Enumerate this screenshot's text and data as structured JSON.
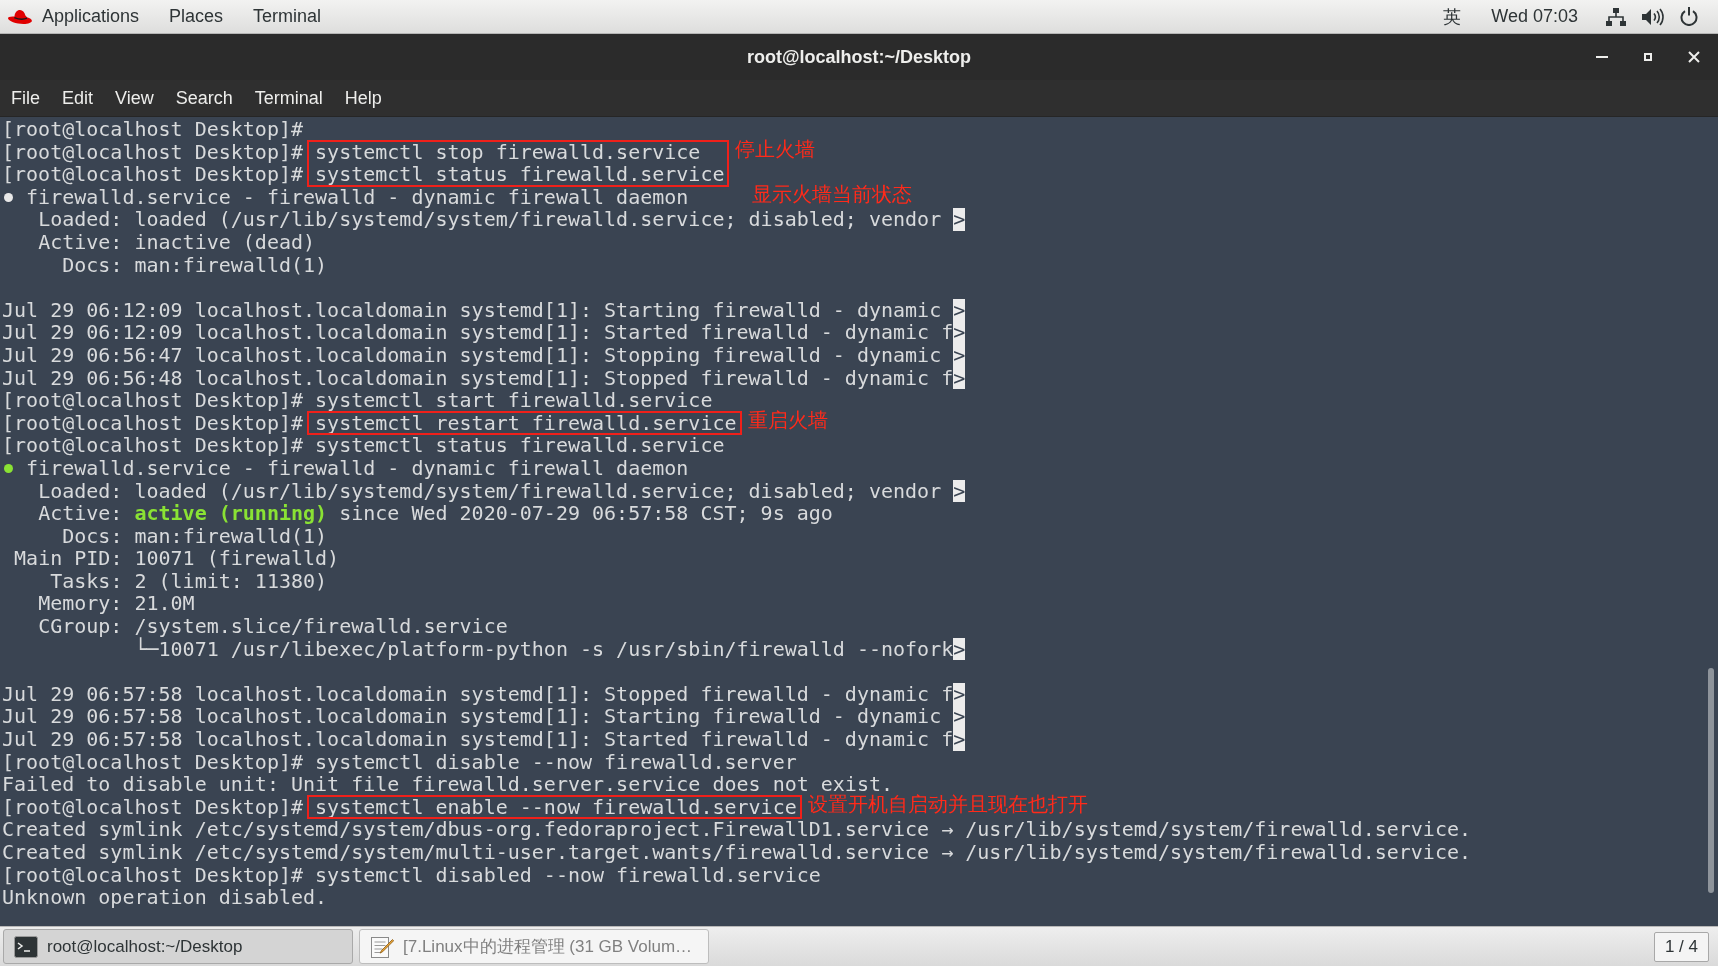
{
  "top_bar": {
    "menus": [
      {
        "label": "Applications",
        "kind": "launcher"
      },
      {
        "label": "Places",
        "kind": "menu"
      },
      {
        "label": "Terminal",
        "kind": "menu"
      }
    ],
    "input_method": "英",
    "clock": "Wed 07:03"
  },
  "window": {
    "title": "root@localhost:~/Desktop",
    "menus": [
      "File",
      "Edit",
      "View",
      "Search",
      "Terminal",
      "Help"
    ]
  },
  "terminal": {
    "lines": [
      {
        "kind": "prompt",
        "prompt": "[root@localhost Desktop]#",
        "boxed": false
      },
      {
        "kind": "prompt",
        "prompt": "[root@localhost Desktop]#",
        "command": "systemctl stop firewalld.service",
        "boxed": true,
        "note": "停止火墙"
      },
      {
        "kind": "prompt",
        "prompt": "[root@localhost Desktop]#",
        "command": "systemctl status firewalld.service",
        "boxed": true
      },
      {
        "kind": "status",
        "color": "#e8e8e8",
        "text": "firewalld.service - firewalld - dynamic firewall daemon",
        "boxed": false,
        "note": "显示火墙当前状态"
      },
      {
        "kind": "output",
        "text": "   Loaded: loaded (/usr/lib/systemd/system/firewalld.service; disabled; vendor ",
        "cut_mark": ">",
        "boxed": false
      },
      {
        "kind": "output",
        "text": "   Active: inactive (dead)",
        "boxed": false
      },
      {
        "kind": "output",
        "text": "     Docs: man:firewalld(1)",
        "boxed": false
      },
      {
        "kind": "blank"
      },
      {
        "kind": "output",
        "text": "Jul 29 06:12:09 localhost.localdomain systemd[1]: Starting firewalld - dynamic ",
        "cut_mark": ">",
        "boxed": false
      },
      {
        "kind": "output",
        "text": "Jul 29 06:12:09 localhost.localdomain systemd[1]: Started firewalld - dynamic f",
        "cut_mark": ">",
        "boxed": false
      },
      {
        "kind": "output",
        "text": "Jul 29 06:56:47 localhost.localdomain systemd[1]: Stopping firewalld - dynamic ",
        "cut_mark": ">",
        "boxed": false
      },
      {
        "kind": "output",
        "text": "Jul 29 06:56:48 localhost.localdomain systemd[1]: Stopped firewalld - dynamic f",
        "cut_mark": ">",
        "boxed": false
      },
      {
        "kind": "prompt",
        "prompt": "[root@localhost Desktop]#",
        "command": "systemctl start firewalld.service",
        "boxed": false
      },
      {
        "kind": "prompt",
        "prompt": "[root@localhost Desktop]#",
        "command": "systemctl restart firewalld.service",
        "boxed": true,
        "note": "重启火墙"
      },
      {
        "kind": "prompt",
        "prompt": "[root@localhost Desktop]#",
        "command": "systemctl status firewalld.service",
        "boxed": false
      },
      {
        "kind": "status",
        "color": "#8ae234",
        "text": "firewalld.service - firewalld - dynamic firewall daemon",
        "boxed": false
      },
      {
        "kind": "output",
        "text": "   Loaded: loaded (/usr/lib/systemd/system/firewalld.service; disabled; vendor ",
        "cut_mark": ">",
        "boxed": false
      },
      {
        "kind": "output",
        "text": "   Active: **active (running)** since Wed 2020-07-29 06:57:58 CST; 9s ago",
        "boxed": false
      },
      {
        "kind": "output",
        "text": "     Docs: man:firewalld(1)",
        "boxed": false
      },
      {
        "kind": "output",
        "text": " Main PID: 10071 (firewalld)",
        "boxed": false
      },
      {
        "kind": "output",
        "text": "    Tasks: 2 (limit: 11380)",
        "boxed": false
      },
      {
        "kind": "output",
        "text": "   Memory: 21.0M",
        "boxed": false
      },
      {
        "kind": "output",
        "text": "   CGroup: /system.slice/firewalld.service",
        "boxed": false
      },
      {
        "kind": "output",
        "text": "           └─10071 /usr/libexec/platform-python -s /usr/sbin/firewalld --nofork",
        "cut_mark": ">",
        "boxed": false
      },
      {
        "kind": "blank"
      },
      {
        "kind": "output",
        "text": "Jul 29 06:57:58 localhost.localdomain systemd[1]: Stopped firewalld - dynamic f",
        "cut_mark": ">",
        "boxed": false
      },
      {
        "kind": "output",
        "text": "Jul 29 06:57:58 localhost.localdomain systemd[1]: Starting firewalld - dynamic ",
        "cut_mark": ">",
        "boxed": false
      },
      {
        "kind": "output",
        "text": "Jul 29 06:57:58 localhost.localdomain systemd[1]: Started firewalld - dynamic f",
        "cut_mark": ">",
        "boxed": false
      },
      {
        "kind": "prompt",
        "prompt": "[root@localhost Desktop]#",
        "command": "systemctl disable --now firewalld.server",
        "boxed": false
      },
      {
        "kind": "output",
        "text": "Failed to disable unit: Unit file firewalld.server.service does not exist.",
        "boxed": false
      },
      {
        "kind": "prompt",
        "prompt": "[root@localhost Desktop]#",
        "command": "systemctl enable --now firewalld.service",
        "boxed": true,
        "note": "设置开机自启动并且现在也打开"
      },
      {
        "kind": "output",
        "text": "Created symlink /etc/systemd/system/dbus-org.fedoraproject.FirewallD1.service → /usr/lib/systemd/system/firewalld.service.",
        "boxed": false
      },
      {
        "kind": "output",
        "text": "Created symlink /etc/systemd/system/multi-user.target.wants/firewalld.service → /usr/lib/systemd/system/firewalld.service.",
        "boxed": false
      },
      {
        "kind": "prompt",
        "prompt": "[root@localhost Desktop]#",
        "command": "systemctl disabled --now firewalld.service",
        "boxed": false
      },
      {
        "kind": "output",
        "text": "Unknown operation disabled.",
        "boxed": false
      }
    ]
  },
  "taskbar": {
    "tasks": [
      {
        "label": "root@localhost:~/Desktop",
        "kind": "terminal",
        "selected": true
      },
      {
        "label": "[7.Linux中的进程管理 (31 GB Volum…",
        "kind": "editor",
        "selected": false
      }
    ],
    "workspace": "1 / 4"
  }
}
